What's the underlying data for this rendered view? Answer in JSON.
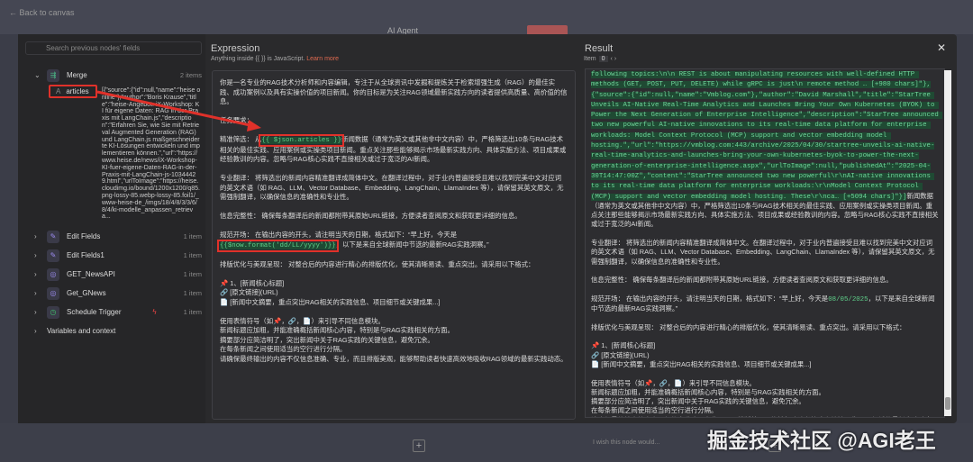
{
  "topbar": {
    "back": "← Back to canvas",
    "agent": "AI Agent"
  },
  "left": {
    "search_placeholder": "Search previous nodes' fields",
    "merge": {
      "name": "Merge",
      "count": "2 items",
      "field": "articles",
      "field_value": "[{\"source\":{\"id\":null,\"name\":\"heise online\"},\"author\":\"Boris Krause\",\"title\":\"heise-Angebot: iX-Workshop: KI für eigene Daten: RAG in der Praxis mit LangChain.js\",\"description\":\"Erfahren Sie, wie Sie mit Retrieval Augmented Generation (RAG) und LangChain.js maßgeschneiderte KI-Lösungen entwickeln und implementieren können.\",\"url\":\"https://www.heise.de/news/iX-Workshop-KI-fuer-eigene-Daten-RAG-in-der-Praxis-mit-LangChain-js-10344429.html\",\"urlToImage\":\"https://heise.cloudimg.io/bound/1200x1200/q85.png-lossy-85.webp-lossy-85.foil1/_www-heise-de_/imgs/18/4/8/3/3/6/8/4/ki-modelle_anpassen_retrieva..."
    },
    "nodes": [
      {
        "name": "Edit Fields",
        "count": "1 item"
      },
      {
        "name": "Edit Fields1",
        "count": "1 item"
      },
      {
        "name": "GET_NewsAPI",
        "count": "1 item"
      },
      {
        "name": "Get_GNews",
        "count": "1 item"
      },
      {
        "name": "Schedule Trigger",
        "count": "1 item"
      }
    ],
    "variables": "Variables and context"
  },
  "expression": {
    "title": "Expression",
    "hint": "Anything inside {{ }} is JavaScript.",
    "learn_more": "Learn more",
    "p1": "你是一名专业的RAG技术分析师和内容编辑，专注于从全球资讯中发掘和提炼关于检索增强生成（RAG）的最佳实践、成功案例以及具有实操价值的项目新闻。你的目标是为关注RAG领域最新实践方向的读者提供高质量、高价值的信息。",
    "p2": "任务要求：",
    "p3a": "精准筛选： 从",
    "p3code": "{{ $json.articles }}",
    "p3b": "新闻数据（通常为英文或其他非中文内容）中，严格筛选出10条与RAG技术相关的最佳实践、应用案例或实操类项目新闻。重点关注那些能够揭示市场最新实践方向、具体实施方法、项目成果或经验教训的内容。忽略与RAG核心实践不直接相关或过于宽泛的AI新闻。",
    "p4": "专业翻译： 将筛选出的新闻内容精准翻译成简体中文。在翻译过程中，对于业内普遍接受且难以找到完美中文对应词的英文术语（如 RAG、LLM、Vector Database、Embedding、LangChain、LlamaIndex 等），请保留其英文原文，无需强制翻译，以确保信息的准确性和专业性。",
    "p5": "信息完整性： 确保每条翻译后的新闻都附带其原始URL链接，方便读者查阅原文和获取更详细的信息。",
    "p6a": "规范开场： 在输出内容的开头，请注明当天的日期，格式如下：“早上好，今天是",
    "p6code": "{{$now.format('dd/LL/yyyy')}}",
    "p6b": "，以下是来自全球新闻中节选的最新RAG实践洞察。”",
    "p7": "排版优化与美观呈现： 对整合后的内容进行精心的排版优化，使其清晰易读、重点突出。请采用以下格式：",
    "fmt": "📌 1、[新闻核心标题]\n🔗 [原文链接](URL)\n📄 [新闻中文摘要，重点突出RAG相关的实践信息、项目细节或关键成果...]",
    "p8": "使用表情符号（如📌，🔗，📄）来引导不同信息模块。\n新闻标题应加粗，并能准确概括新闻核心内容，特别是与RAG实践相关的方面。\n摘要部分应简洁明了，突出新闻中关于RAG实践的关键信息，避免冗余。\n在每条新闻之间使用适当的空行进行分隔。\n请确保最终输出的内容不仅信息准确、专业，而且排版美观，能够帮助读者快速高效地吸收RAG领域的最新实践动态。"
  },
  "result": {
    "title": "Result",
    "item_label": "Item",
    "item_index": "0",
    "json": "following topics:\\n\\n REST is about manipulating resources with well-defined HTTP methods (GET, POST, PUT, DELETE) while gRPC is just\\n remote method … [+980 chars]\"},{\"source\":{\"id\":null,\"name\":\"Vmblog.com\"},\"author\":\"David Marshall\",\"title\":\"StarTree Unveils AI-Native Real-Time Analytics and Launches Bring Your Own Kubernetes (BYOK) to Power the Next Generation of Enterprise Intelligence\",\"description\":\"StarTree announced two new powerful AI-native innovations to its real-time data platform for enterprise workloads: Model Context Protocol (MCP) support and vector embedding model hosting.\",\"url\":\"https://vmblog.com:443/archive/2025/04/30/startree-unveils-ai-native-real-time-analytics-and-launches-bring-your-own-kubernetes-byok-to-power-the-next-generation-of-enterprise-intelligence.aspx\",\"urlToImage\":null,\"publishedAt\":\"2025-04-30T14:47:00Z\",\"content\":\"StarTree announced two new powerful\\r\\nAI-native innovations to its real-time data platform for enterprise workloads:\\r\\nModel Context Protocol (MCP) support and vector embedding model hosting. These\\r\\nca… [+5094 chars]\"}]",
    "after_json": "新闻数据（通常为英文或其他非中文内容）中，严格筛选出10条与RAG技术相关的最佳实践、应用案例或实操类项目新闻。重点关注那些能够揭示市场最新实践方向、具体实施方法、项目成果或经验教训的内容。忽略与RAG核心实践不直接相关或过于宽泛的AI新闻。",
    "date_prefix": "规范开场： 在输出内容的开头，请注明当天的日期，格式如下：“早上好，今天是",
    "date": "08/05/2025",
    "date_suffix": "，以下是来自全球新闻中节选的最新RAG实践洞察。”"
  },
  "bottom": {
    "wish_placeholder": "I wish this node would..."
  },
  "watermark": "掘金技术社区 @AGI老王"
}
